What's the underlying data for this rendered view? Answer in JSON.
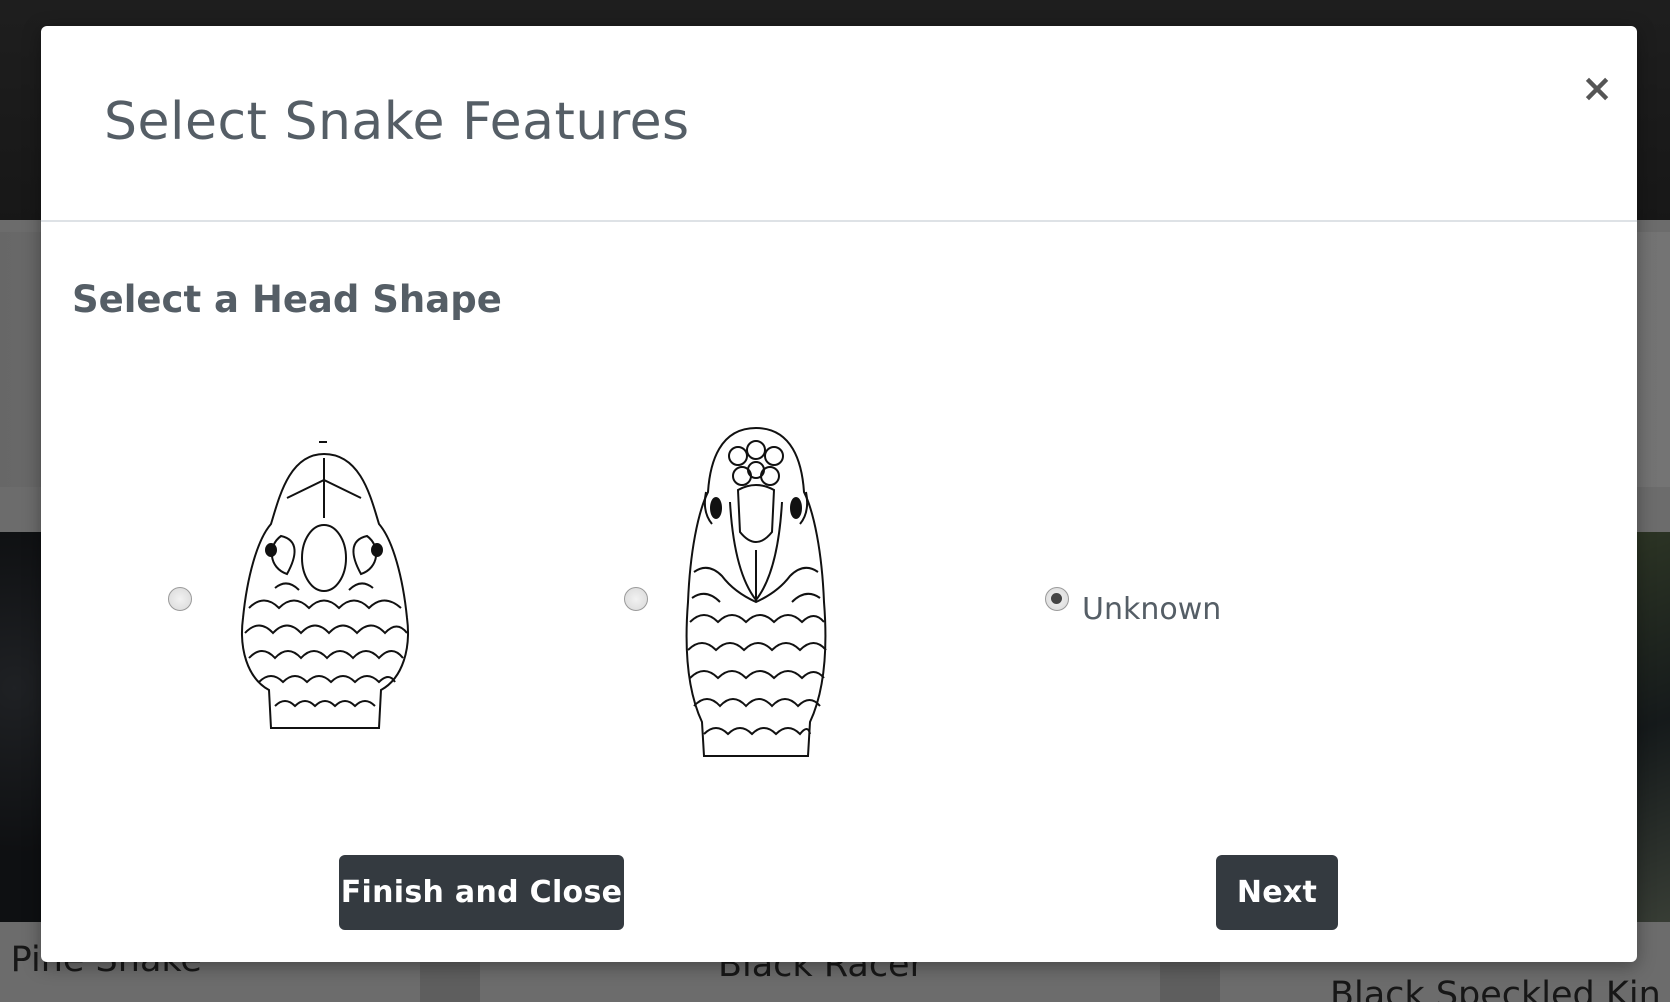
{
  "modal": {
    "title": "Select Snake Features",
    "close_label": "×",
    "section_title": "Select a Head Shape",
    "options": [
      {
        "type": "image",
        "icon": "snake-head-broad-icon",
        "selected": false
      },
      {
        "type": "image",
        "icon": "snake-head-narrow-icon",
        "selected": false
      },
      {
        "type": "text",
        "label": "Unknown",
        "selected": true
      }
    ],
    "finish_label": "Finish and Close",
    "next_label": "Next"
  },
  "background": {
    "cards": [
      "ck Pine Snake",
      "Black Racer",
      "Black Speckled Kin"
    ]
  },
  "colors": {
    "button_bg": "#343a40",
    "title_text": "#555e66",
    "overlay": "rgba(0,0,0,0.5)"
  }
}
